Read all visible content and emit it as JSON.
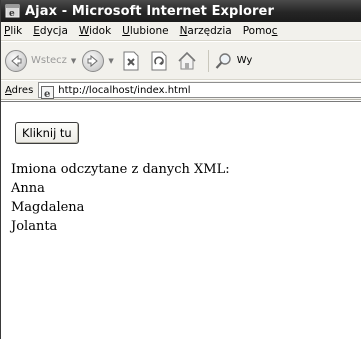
{
  "window": {
    "title": "Ajax - Microsoft Internet Explorer"
  },
  "menu": [
    {
      "u": "P",
      "rest": "lik"
    },
    {
      "u": "E",
      "rest": "dycja"
    },
    {
      "u": "W",
      "rest": "idok"
    },
    {
      "u": "U",
      "rest": "lubione"
    },
    {
      "u": "N",
      "rest": "arzędzia"
    },
    {
      "pre": "Pomo",
      "u": "c",
      "rest": ""
    }
  ],
  "toolbar": {
    "back_label": "Wstecz",
    "search_label": "Wy"
  },
  "address": {
    "label_u": "A",
    "label_rest": "dres",
    "url": "http://localhost/index.html"
  },
  "page": {
    "button_label": "Kliknij tu",
    "heading": "Imiona odczytane z danych XML:",
    "names": [
      "Anna",
      "Magdalena",
      "Jolanta"
    ]
  },
  "icons": {
    "title": "ie-window-icon",
    "back": "back-arrow-icon",
    "forward": "forward-arrow-icon",
    "stop": "stop-icon",
    "refresh": "refresh-icon",
    "home": "home-icon",
    "search": "search-icon",
    "page": "ie-page-icon"
  }
}
